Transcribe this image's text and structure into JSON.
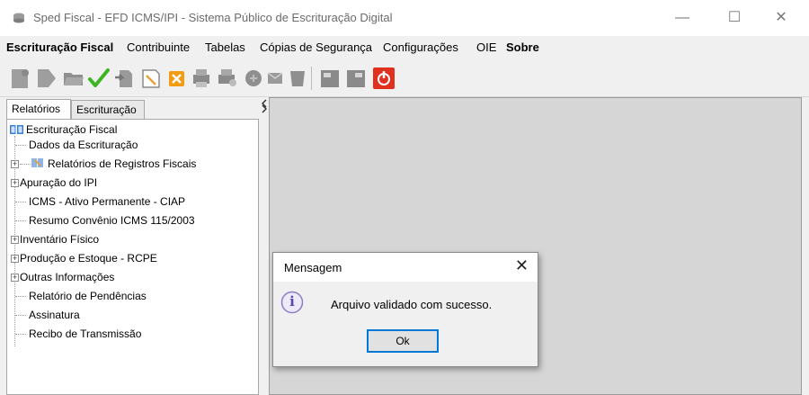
{
  "window": {
    "title": "Sped Fiscal - EFD ICMS/IPI - Sistema Público de Escrituração Digital",
    "minimize": "—",
    "maximize": "☐",
    "close": "✕"
  },
  "menu": {
    "items": [
      "Escrituração Fiscal",
      "Contribuinte",
      "Tabelas",
      "Cópias de Segurança",
      "Configurações",
      "OIE",
      "Sobre"
    ]
  },
  "toolbar": {
    "icons": [
      "new-document-icon",
      "open-document-icon",
      "folder-icon",
      "validate-check-icon",
      "import-icon",
      "edit-document-icon",
      "delete-icon",
      "print-icon",
      "print-preview-icon",
      "sign-icon",
      "transmit-icon",
      "backup-icon",
      "report-icon",
      "report-alt-icon",
      "exit-icon"
    ]
  },
  "left_panel": {
    "tabs": [
      "Relatórios",
      "Escrituração"
    ],
    "active_tab": "Relatórios",
    "tree": {
      "root": "Escrituração Fiscal",
      "items": [
        {
          "label": "Dados da Escrituração",
          "expandable": false
        },
        {
          "label": "Relatórios de Registros Fiscais",
          "expandable": true
        },
        {
          "label": "Apuração do IPI",
          "expandable": true
        },
        {
          "label": "ICMS - Ativo Permanente - CIAP",
          "expandable": false
        },
        {
          "label": "Resumo  Convênio ICMS 115/2003",
          "expandable": false
        },
        {
          "label": "Inventário Físico",
          "expandable": true
        },
        {
          "label": "Produção e Estoque - RCPE",
          "expandable": true
        },
        {
          "label": "Outras Informações",
          "expandable": true
        },
        {
          "label": "Relatório de Pendências",
          "expandable": false
        },
        {
          "label": "Assinatura",
          "expandable": false
        },
        {
          "label": "Recibo de Transmissão",
          "expandable": false
        }
      ]
    }
  },
  "dialog": {
    "title": "Mensagem",
    "close": "✕",
    "message": "Arquivo validado com sucesso.",
    "ok_label": "Ok",
    "info_glyph": "i"
  },
  "colors": {
    "accent": "#0078d7",
    "check_green": "#3cb521",
    "exit_red": "#e0301e",
    "orange": "#f39c12"
  }
}
